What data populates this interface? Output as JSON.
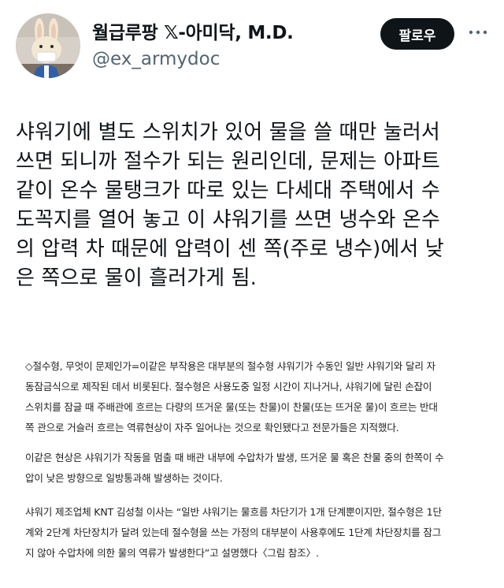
{
  "author": {
    "display_name": "월급루팡 𝕏-아미닥, M.D.",
    "handle": "@ex_armydoc",
    "avatar_icon": "plush-bunny-avatar"
  },
  "actions": {
    "follow_label": "팔로우",
    "more_icon": "more-horizontal-icon"
  },
  "tweet": {
    "lines": [
      "샤워기에 별도 스위치가 있어 물을 쓸 때만 눌러서",
      "쓰면 되니까 절수가 되는 원리인데, 문제는 아파트",
      "같이 온수 물탱크가 따로 있는 다세대 주택에서 수",
      "도꼭지를 열어 놓고 이 샤워기를 쓰면 냉수와 온수",
      "의 압력 차 때문에 압력이 센 쪽(주로 냉수)에서 낮",
      "은 쪽으로 물이 흘러가게 됨."
    ]
  },
  "article_excerpt": {
    "paragraphs": [
      [
        "◇절수형, 무엇이 문제인가=이같은 부작용은 대부분의 절수형 샤워기가 수동인 일반 샤워기와 달리 자",
        "동잠금식으로 제작된 데서 비롯된다. 절수형은 사용도중 일정 시간이 지나거나, 샤워기에 달린 손잡이",
        "스위치를 잠글 때 주배관에 흐르는 다량의 뜨거운 물(또는 찬물)이 찬물(또는 뜨거운 물)이 흐르는 반대",
        "쪽 관으로 거슬러 흐르는 역류현상이 자주 일어나는 것으로 확인됐다고 전문가들은 지적했다."
      ],
      [
        "이같은 현상은 샤워기가 작동을 멈출 때 배관 내부에 수압차가 발생, 뜨거운 물 혹은 찬물 중의 한쪽이 수",
        "압이 낮은 방향으로 일방통과해 발생하는 것이다."
      ],
      [
        "샤워기 제조업체 KNT 김성철 이사는 “일반 샤워기는 물흐름 차단기가 1개 단계뿐이지만, 절수형은 1단",
        "계와 2단계 차단장치가 달려 있는데 절수형을 쓰는 가정의 대부분이 사용후에도 1단계 차단장치를 잠그",
        "지 않아 수압차에 의한 물의 역류가 발생한다”고 설명했다〈그림 참조〉."
      ]
    ]
  }
}
